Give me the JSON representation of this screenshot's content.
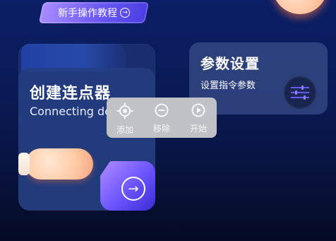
{
  "tutorial": {
    "label": "新手操作教程",
    "icon": "arrow-right-circle-icon"
  },
  "cards": {
    "left": {
      "title": "创建连点器",
      "subtitle": "Connecting de",
      "button_icon": "arrow-right-circle-icon"
    },
    "right": {
      "title": "参数设置",
      "subtitle": "设置指令参数",
      "icon": "sliders-icon"
    }
  },
  "popup_menu": {
    "items": [
      {
        "label": "添加",
        "icon": "target-icon"
      },
      {
        "label": "移除",
        "icon": "minus-circle-icon"
      },
      {
        "label": "开始",
        "icon": "play-circle-icon"
      }
    ]
  },
  "colors": {
    "background_top": "#0b1f66",
    "background_bottom": "#050b25",
    "accent_purple": "#6c59f5",
    "accent_blue": "#1f52ff",
    "menu_bg": "#c7c8c9"
  }
}
